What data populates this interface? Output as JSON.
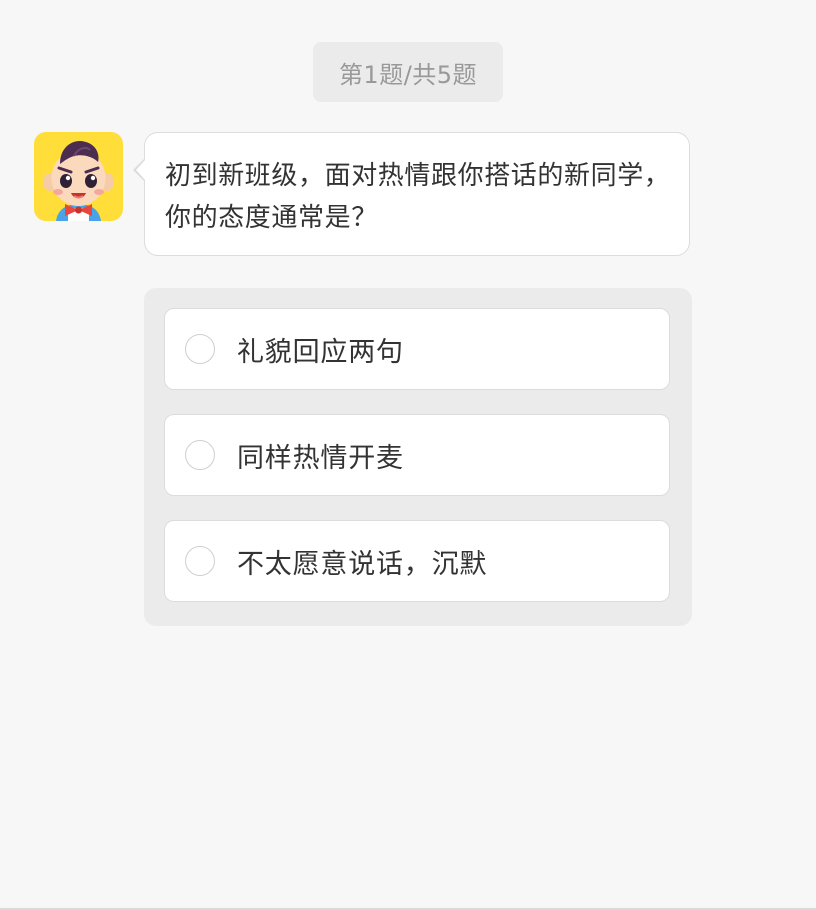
{
  "progress": {
    "label": "第1题/共5题",
    "current": 1,
    "total": 5
  },
  "question": {
    "text": "初到新班级，面对热情跟你搭话的新同学，你的态度通常是？"
  },
  "options": [
    {
      "label": "礼貌回应两句",
      "selected": false
    },
    {
      "label": "同样热情开麦",
      "selected": false
    },
    {
      "label": "不太愿意说话，沉默",
      "selected": false
    }
  ],
  "colors": {
    "background": "#f7f7f7",
    "avatar_background": "#ffde3a",
    "text": "#333333",
    "muted_text": "#999999",
    "panel": "#ebebeb",
    "border": "#dcdcdc"
  },
  "icons": {
    "avatar": "cartoon-boy-avatar-icon",
    "radio": "radio-circle-icon"
  }
}
